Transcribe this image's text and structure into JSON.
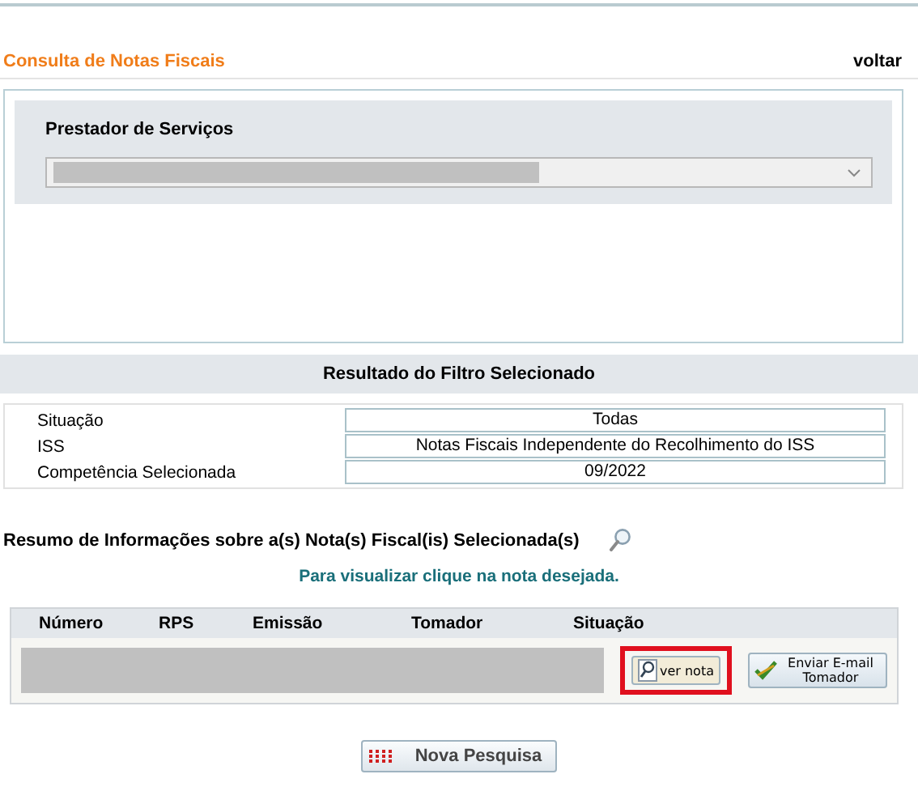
{
  "header": {
    "title": "Consulta de Notas Fiscais",
    "back_link": "voltar"
  },
  "filter": {
    "label": "Prestador de Serviços",
    "select": {
      "redacted": true
    }
  },
  "result": {
    "title": "Resultado do Filtro Selecionado",
    "rows": [
      {
        "label": "Situação",
        "value": "Todas"
      },
      {
        "label": "ISS",
        "value": "Notas Fiscais Independente do Recolhimento do ISS"
      },
      {
        "label": "Competência Selecionada",
        "value": "09/2022"
      }
    ]
  },
  "summary": {
    "title": "Resumo de Informações sobre a(s) Nota(s) Fiscal(is) Selecionada(s)",
    "hint": "Para visualizar clique na nota desejada."
  },
  "table": {
    "columns": [
      "Número",
      "RPS",
      "Emissão",
      "Tomador",
      "Situação"
    ],
    "rows": [
      {
        "redacted": true,
        "view_button": "ver nota",
        "view_highlighted": true,
        "email_button": "Enviar E-mail Tomador"
      }
    ]
  },
  "new_search_button": "Nova Pesquisa"
}
